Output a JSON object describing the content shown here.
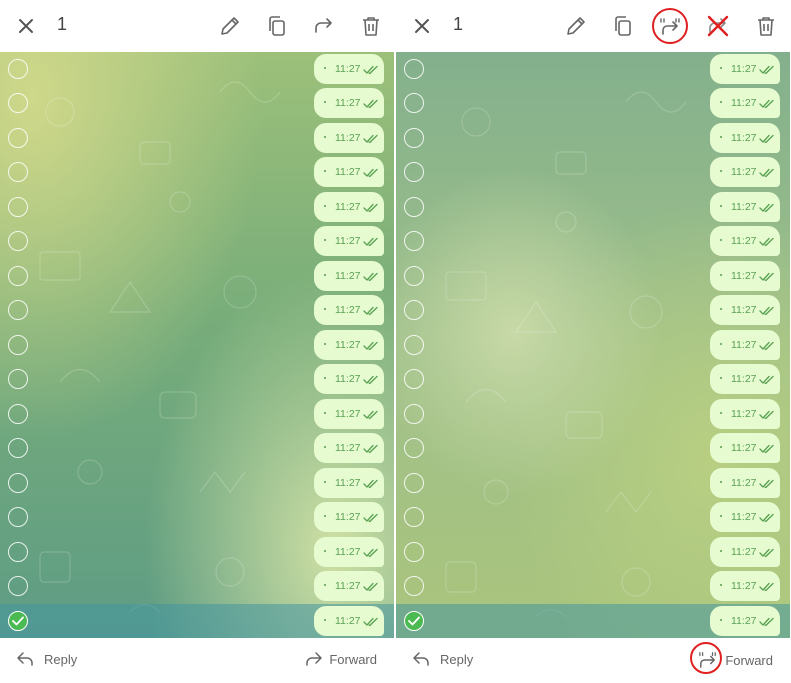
{
  "colors": {
    "accent_green": "#4cba52",
    "bubble_bg": "#e6fcd0",
    "time_text": "#5aa053",
    "highlight_red": "#e02020",
    "icon_gray": "#666666"
  },
  "panels": [
    {
      "id": "left",
      "topbar": {
        "close_icon": "close-icon",
        "selected_count": "1",
        "actions": [
          "pencil-icon",
          "copy-icon",
          "forward-arrow-icon",
          "trash-icon"
        ]
      },
      "messages": {
        "time_label": "11:27",
        "status_icon": "double-check-icon",
        "row_count": 17,
        "selected_index": 16
      },
      "bottombar": {
        "reply_label": "Reply",
        "forward_label": "Forward"
      }
    },
    {
      "id": "right",
      "topbar": {
        "close_icon": "close-icon",
        "selected_count": "1",
        "actions": [
          "pencil-icon",
          "copy-icon",
          "quote-forward-icon",
          "crossed-forward-icon",
          "trash-icon"
        ],
        "highlighted": [
          "quote-forward-icon",
          "crossed-forward-icon"
        ]
      },
      "messages": {
        "time_label": "11:27",
        "status_icon": "double-check-icon",
        "row_count": 17,
        "selected_index": 16
      },
      "bottombar": {
        "reply_label": "Reply",
        "forward_label": "Forward",
        "forward_icon": "quote-forward-icon"
      }
    }
  ]
}
